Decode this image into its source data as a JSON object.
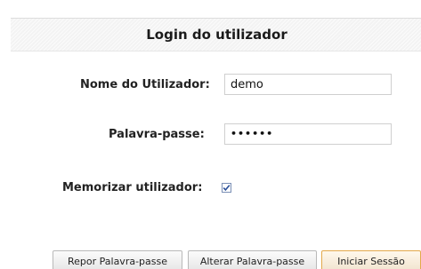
{
  "login": {
    "title": "Login do utilizador",
    "username_label": "Nome do Utilizador:",
    "username_value": "demo",
    "password_label": "Palavra-passe:",
    "password_value": "••••••",
    "remember_label": "Memorizar utilizador:",
    "remember_checked": true
  },
  "buttons": {
    "reset_password": "Repor Palavra-passe",
    "change_password": "Alterar Palavra-passe",
    "start_session": "Iniciar Sessão"
  },
  "colors": {
    "primary_button_border": "#e3a94b",
    "checkbox_check": "#2a4f9a"
  }
}
